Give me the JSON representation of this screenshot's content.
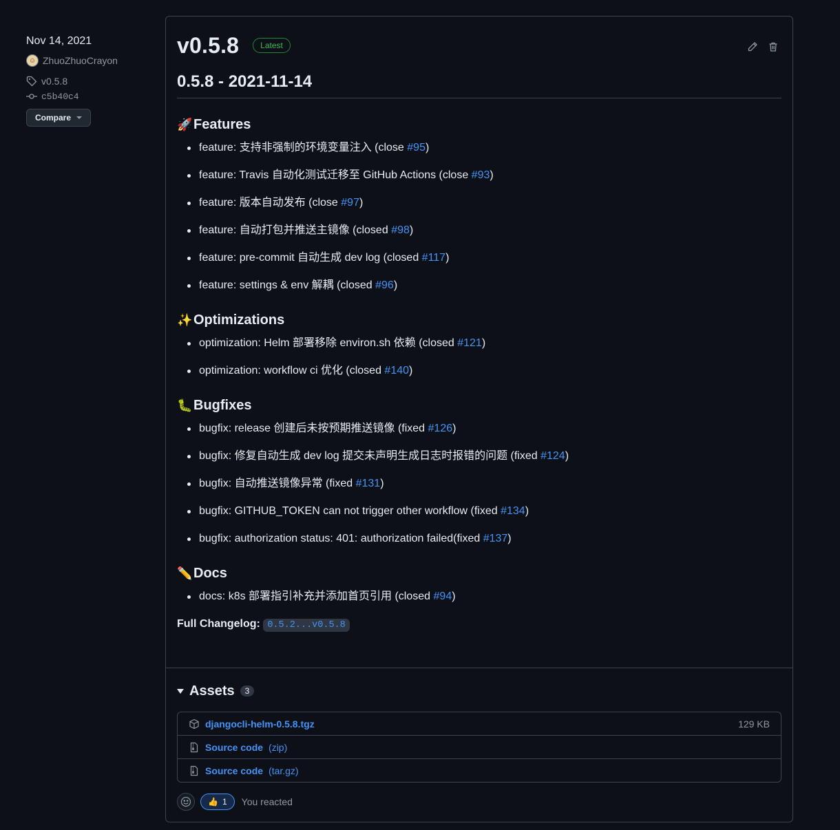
{
  "sidebar": {
    "date": "Nov 14, 2021",
    "author": "ZhuoZhuoCrayon",
    "tag": "v0.5.8",
    "commit": "c5b40c4",
    "compare_label": "Compare"
  },
  "release": {
    "title": "v0.5.8",
    "badge": "Latest",
    "heading": "0.5.8 - 2021-11-14",
    "sections": [
      {
        "emoji": "🚀",
        "title": "Features",
        "items": [
          {
            "text": "feature: 支持非强制的环境变量注入 (close ",
            "ref": "#95",
            "end": ")"
          },
          {
            "text": "feature: Travis 自动化测试迁移至 GitHub Actions (close ",
            "ref": "#93",
            "end": ")"
          },
          {
            "text": "feature: 版本自动发布 (close ",
            "ref": "#97",
            "end": ")"
          },
          {
            "text": "feature: 自动打包并推送主镜像 (closed ",
            "ref": "#98",
            "end": ")"
          },
          {
            "text": "feature: pre-commit 自动生成 dev log (closed ",
            "ref": "#117",
            "end": ")"
          },
          {
            "text": "feature: settings & env 解耦 (closed ",
            "ref": "#96",
            "end": ")"
          }
        ]
      },
      {
        "emoji": "✨",
        "title": "Optimizations",
        "items": [
          {
            "text": "optimization: Helm 部署移除 environ.sh 依赖 (closed ",
            "ref": "#121",
            "end": ")"
          },
          {
            "text": "optimization: workflow ci 优化 (closed ",
            "ref": "#140",
            "end": ")"
          }
        ]
      },
      {
        "emoji": "🐛",
        "title": "Bugfixes",
        "items": [
          {
            "text": "bugfix: release 创建后未按预期推送镜像 (fixed ",
            "ref": "#126",
            "end": ")"
          },
          {
            "text": "bugfix: 修复自动生成 dev log 提交未声明生成日志时报错的问题 (fixed ",
            "ref": "#124",
            "end": ")"
          },
          {
            "text": "bugfix: 自动推送镜像异常 (fixed ",
            "ref": "#131",
            "end": ")"
          },
          {
            "text": "bugfix: GITHUB_TOKEN can not trigger other workflow (fixed ",
            "ref": "#134",
            "end": ")"
          },
          {
            "text": "bugfix: authorization status: 401: authorization failed(fixed ",
            "ref": "#137",
            "end": ")"
          }
        ]
      },
      {
        "emoji": "✏️",
        "title": "Docs",
        "items": [
          {
            "text": "docs: k8s 部署指引补充并添加首页引用 (closed ",
            "ref": "#94",
            "end": ")"
          }
        ]
      }
    ],
    "changelog_label": "Full Changelog:",
    "changelog_link": "0.5.2...v0.5.8"
  },
  "assets": {
    "title": "Assets",
    "count": "3",
    "files": [
      {
        "name": "djangocli-helm-0.5.8.tgz",
        "sub": "",
        "size": "129 KB",
        "icon": "package-icon"
      },
      {
        "name": "Source code",
        "sub": "(zip)",
        "size": "",
        "icon": "file-zip-icon"
      },
      {
        "name": "Source code",
        "sub": "(tar.gz)",
        "size": "",
        "icon": "file-zip-icon"
      }
    ]
  },
  "reactions": {
    "emoji": "👍",
    "count": "1",
    "text": "You reacted"
  },
  "colors": {
    "background": "#0d1117",
    "border": "#3d444d",
    "link": "#4493f8",
    "latest_green": "#3fb950"
  }
}
